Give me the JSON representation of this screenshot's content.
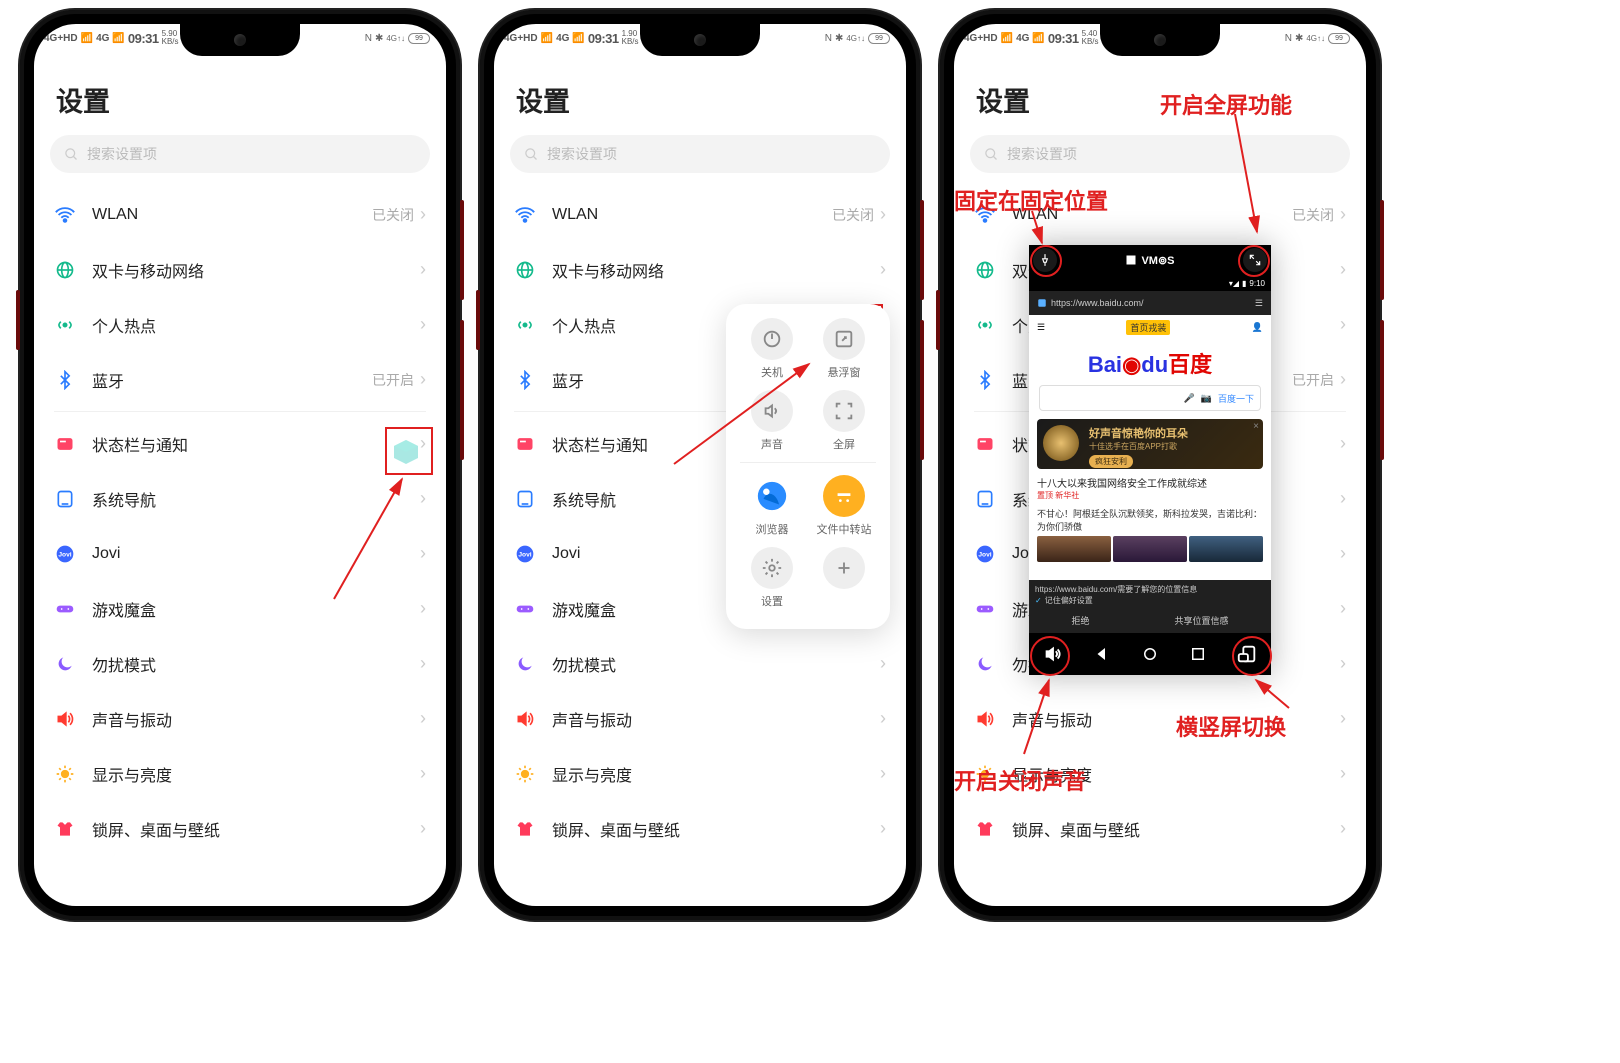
{
  "status": {
    "net": "4G+HD",
    "sig": "4G",
    "time": "09:31",
    "speed1": "5.90",
    "speed1b": "KB/s",
    "speed2": "1.90",
    "speed3": "5.40",
    "nfc": "N",
    "bt": "✱",
    "cell": " 4G↑↓",
    "batt": "99"
  },
  "page_title": "设置",
  "search_placeholder": "搜索设置项",
  "rows": {
    "wlan": {
      "label": "WLAN",
      "value": "已关闭"
    },
    "dual": {
      "label": "双卡与移动网络",
      "value": ""
    },
    "hotspot": {
      "label": "个人热点",
      "value": ""
    },
    "bt": {
      "label": "蓝牙",
      "value": "已开启"
    },
    "status_notif": {
      "label": "状态栏与通知",
      "value": ""
    },
    "sysnav": {
      "label": "系统导航",
      "value": ""
    },
    "jovi": {
      "label": "Jovi",
      "value": ""
    },
    "gamebox": {
      "label": "游戏魔盒",
      "value": ""
    },
    "dnd": {
      "label": "勿扰模式",
      "value": ""
    },
    "sound": {
      "label": "声音与振动",
      "value": ""
    },
    "display": {
      "label": "显示与亮度",
      "value": ""
    },
    "lock": {
      "label": "锁屏、桌面与壁纸",
      "value": ""
    }
  },
  "panel": {
    "power": "关机",
    "float": "悬浮窗",
    "audio": "声音",
    "full": "全屏",
    "browser": "浏览器",
    "filestation": "文件中转站",
    "settings": "设置"
  },
  "vmos": {
    "brand": "VM⊚S",
    "url": "https://www.baidu.com/",
    "login": "首页戎装",
    "dulabel": "百度",
    "search_btn": "百度一下",
    "ad_title": "好声音惊艳你的耳朵",
    "ad_sub": "十佳选手在百度APP打歌",
    "ad_btn": "疯狂安利",
    "news1": "十八大以来我国网络安全工作成就综述",
    "news1_src": "置顶 新华社",
    "news2": "不甘心！阿根廷全队沉默领奖，斯科拉发哭，吉诺比利：为你们骄傲",
    "loc_msg": "https://www.baidu.com/需要了解您的位置信息",
    "loc_remember": "记住偏好设置",
    "loc_deny": "拒绝",
    "loc_allow": "共享位置信感",
    "vmos_time": "9:10"
  },
  "annotations": {
    "fullscreen": "开启全屏功能",
    "pin": "固定在固定位置",
    "rotate": "横竖屏切换",
    "audio_toggle": "开启关闭声音"
  }
}
